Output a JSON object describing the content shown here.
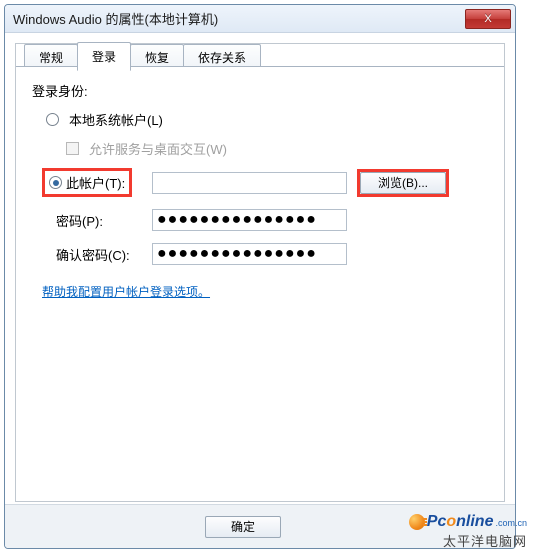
{
  "window": {
    "title": "Windows Audio 的属性(本地计算机)",
    "close_x": "X"
  },
  "tabs": {
    "general": "常规",
    "logon": "登录",
    "recovery": "恢复",
    "dependencies": "依存关系"
  },
  "logon": {
    "heading": "登录身份:",
    "local_system_label": "本地系统帐户(L)",
    "allow_interact_label": "允许服务与桌面交互(W)",
    "this_account_label": "此帐户(T):",
    "account_value": "",
    "browse_label": "浏览(B)...",
    "password_label": "密码(P):",
    "password_value": "●●●●●●●●●●●●●●●",
    "confirm_label": "确认密码(C):",
    "confirm_value": "●●●●●●●●●●●●●●●",
    "help_link": "帮助我配置用户帐户登录选项。"
  },
  "buttons": {
    "ok": "确定"
  },
  "watermark": {
    "line1_a": "Pc",
    "line1_b": "nline",
    "line1_small": ".com.cn",
    "line2": "太平洋电脑网"
  }
}
